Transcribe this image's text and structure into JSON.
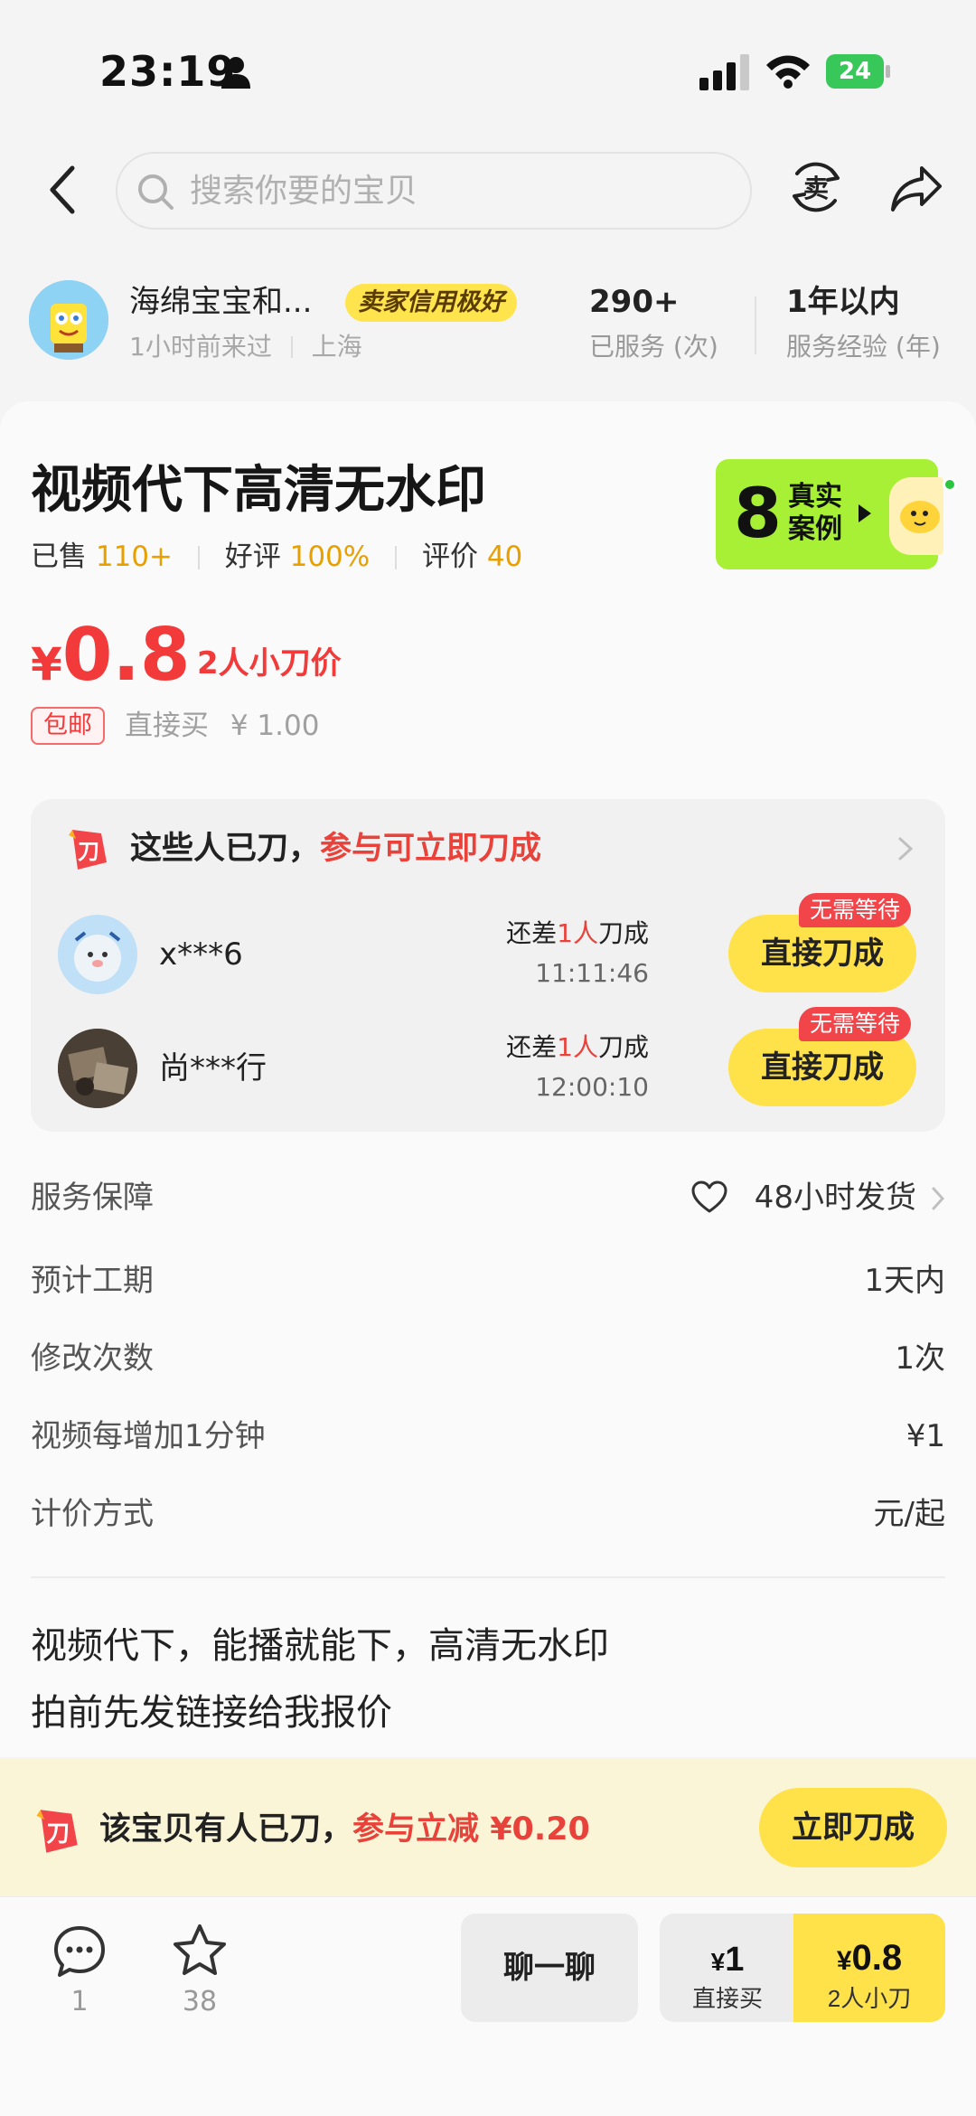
{
  "status_bar": {
    "time": "23:19",
    "battery": "24"
  },
  "nav": {
    "search_placeholder": "搜索你要的宝贝",
    "sell_label": "卖"
  },
  "seller": {
    "name": "海绵宝宝和...",
    "credit_badge": "卖家信用极好",
    "last_seen": "1小时前来过",
    "location": "上海",
    "stats": [
      {
        "value": "290+",
        "label": "已服务 (次)"
      },
      {
        "value": "1年以内",
        "label": "服务经验 (年)"
      }
    ]
  },
  "product": {
    "title": "视频代下高清无水印",
    "case_badge": {
      "count": "8",
      "text": "真实案例"
    },
    "sold_label": "已售",
    "sold_value": "110+",
    "rating_label": "好评",
    "rating_value": "100%",
    "reviews_label": "评价",
    "reviews_value": "40",
    "currency": "¥",
    "price": "0.8",
    "price_label": "2人小刀价",
    "free_shipping": "包邮",
    "direct_buy_label": "直接买",
    "direct_buy_price": "¥ 1.00"
  },
  "group": {
    "title": "这些人已刀，",
    "title_highlight": "参与可立即刀成",
    "knife_char": "刀",
    "rows": [
      {
        "name": "x***6",
        "need_prefix": "还差",
        "need_count": "1人",
        "need_suffix": "刀成",
        "time": "11:11:46",
        "button": "直接刀成",
        "badge": "无需等待"
      },
      {
        "name": "尚***行",
        "need_prefix": "还差",
        "need_count": "1人",
        "need_suffix": "刀成",
        "time": "12:00:10",
        "button": "直接刀成",
        "badge": "无需等待"
      }
    ]
  },
  "service": [
    {
      "label": "服务保障",
      "value": "48小时发货"
    },
    {
      "label": "预计工期",
      "value": "1天内"
    },
    {
      "label": "修改次数",
      "value": "1次"
    },
    {
      "label": "视频每增加1分钟",
      "value": "¥1"
    },
    {
      "label": "计价方式",
      "value": "元/起"
    }
  ],
  "description": [
    "视频代下，能播就能下，高清无水印",
    "拍前先发链接给我报价"
  ],
  "bargain": {
    "text": "该宝贝有人已刀，",
    "highlight": "参与立减 ¥0.20",
    "button": "立即刀成"
  },
  "bottom": {
    "chat_count": "1",
    "star_count": "38",
    "chat_button": "聊一聊",
    "direct_price_cur": "¥",
    "direct_price": "1",
    "direct_label": "直接买",
    "cut_price_cur": "¥",
    "cut_price": "0.8",
    "cut_label": "2人小刀"
  },
  "colors": {
    "accent_yellow": "#ffe14a",
    "price_red": "#f23a3a",
    "case_green": "#a7f035"
  }
}
